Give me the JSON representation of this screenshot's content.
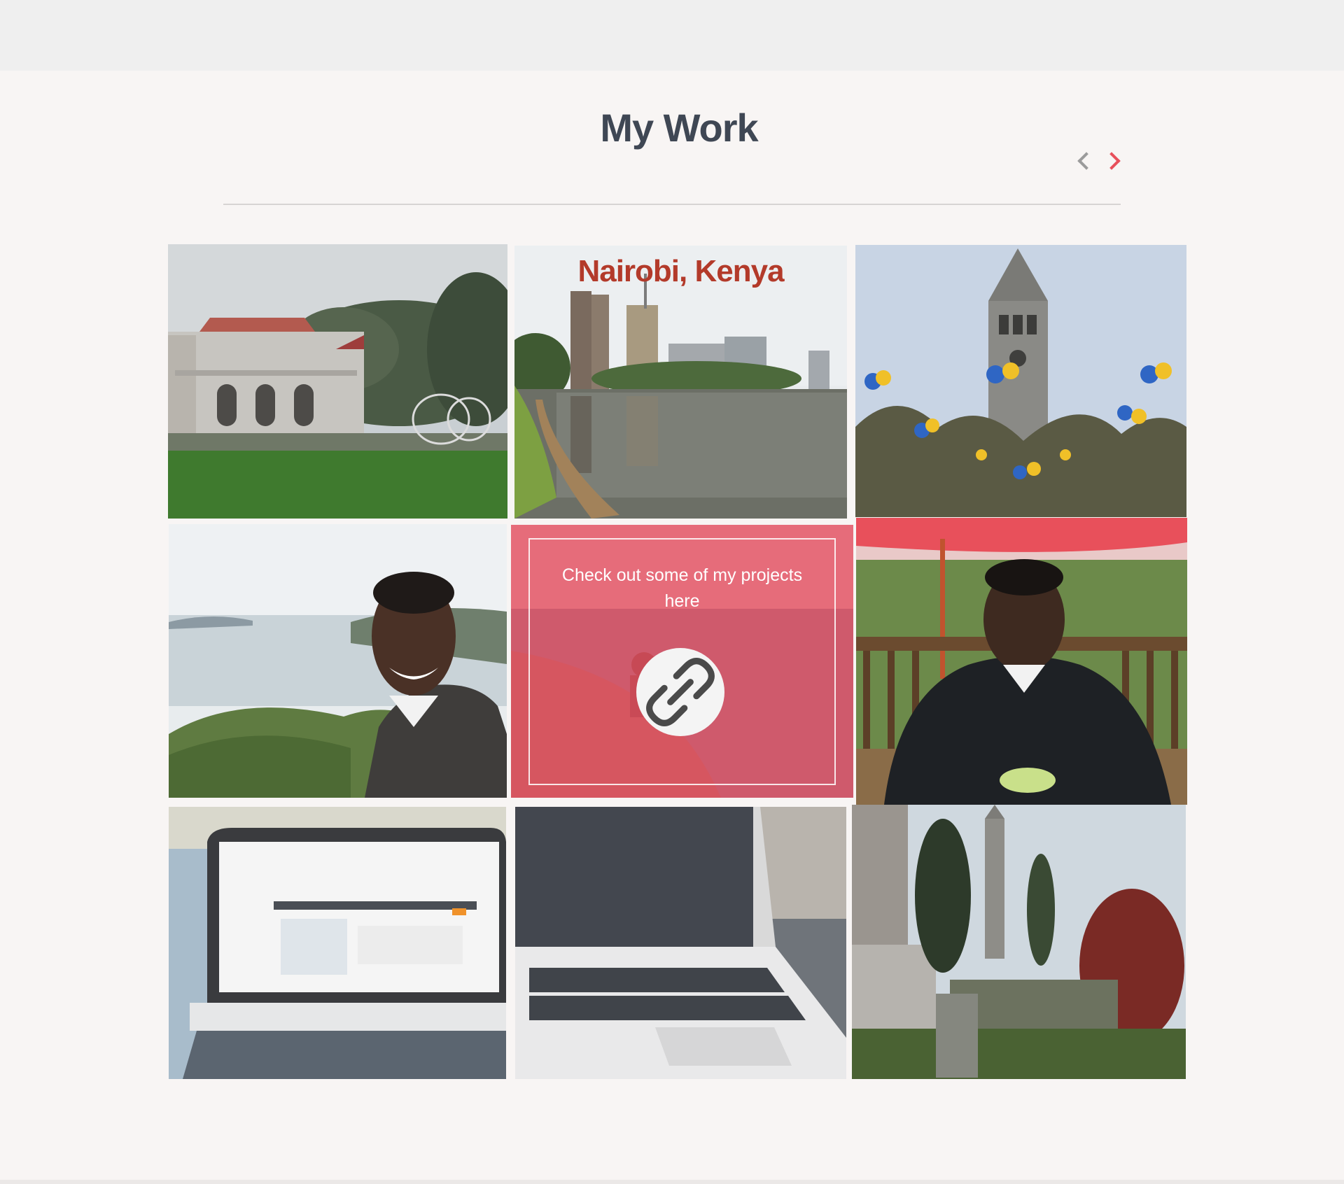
{
  "header": {
    "title": "My Work"
  },
  "nav": {
    "prev_icon": "chevron-left-icon",
    "next_icon": "chevron-right-icon",
    "prev_color": "#9b9b9b",
    "next_color": "#e8505b"
  },
  "gallery": {
    "tile_2_caption": "Nairobi, Kenya",
    "hover_text": "Check out some of my projects here",
    "hover_icon": "link-icon",
    "accent": "#f0505f"
  }
}
